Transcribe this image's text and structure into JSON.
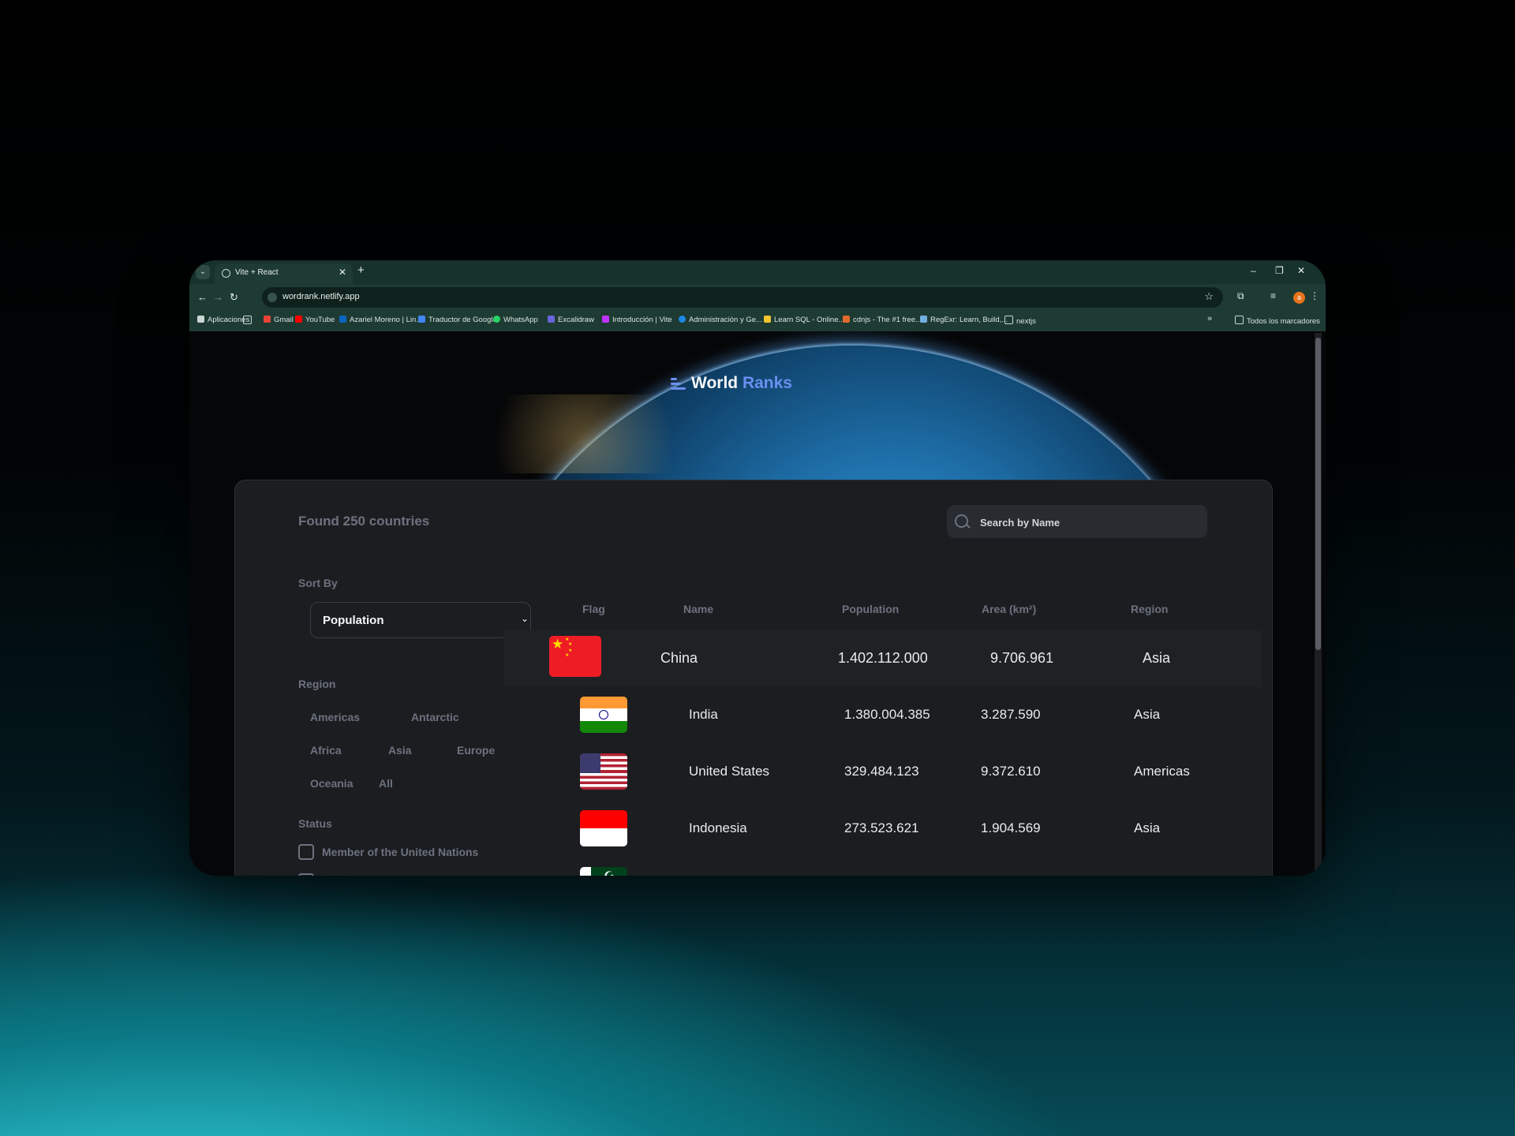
{
  "browser": {
    "tab_title": "Vite + React",
    "url": "wordrank.netlify.app",
    "avatar_initial": "a",
    "bookmarks": [
      "Aplicaciones",
      "Gmail",
      "YouTube",
      "Azariel Moreno | Lin...",
      "Traductor de Google",
      "WhatsApp",
      "Excalidraw",
      "Introducción | Vite",
      "Administración y Ge...",
      "Learn SQL - Online...",
      "cdnjs - The #1 free...",
      "RegExr: Learn, Build,...",
      "nextjs"
    ],
    "bookmarks_overflow": "»",
    "all_bookmarks": "Todos los marcadores"
  },
  "app": {
    "brand_word1": "World",
    "brand_word2": "Ranks",
    "found_text": "Found 250 countries",
    "search_placeholder": "Search by Name",
    "sort_label": "Sort By",
    "sort_value": "Population",
    "region_label": "Region",
    "regions": [
      "Americas",
      "Antarctic",
      "Africa",
      "Asia",
      "Europe",
      "Oceania",
      "All"
    ],
    "status_label": "Status",
    "status_options": [
      "Member of the United Nations"
    ],
    "table_headers": [
      "Flag",
      "Name",
      "Population",
      "Area (km²)",
      "Region"
    ],
    "rows": [
      {
        "name": "China",
        "population": "1.402.112.000",
        "area": "9.706.961",
        "region": "Asia",
        "flag": "china"
      },
      {
        "name": "India",
        "population": "1.380.004.385",
        "area": "3.287.590",
        "region": "Asia",
        "flag": "india"
      },
      {
        "name": "United States",
        "population": "329.484.123",
        "area": "9.372.610",
        "region": "Americas",
        "flag": "usa"
      },
      {
        "name": "Indonesia",
        "population": "273.523.621",
        "area": "1.904.569",
        "region": "Asia",
        "flag": "indonesia"
      }
    ]
  },
  "colors": {
    "accent": "#6b8ff0",
    "panel": "#1b1d20",
    "muted": "#6c727f"
  }
}
